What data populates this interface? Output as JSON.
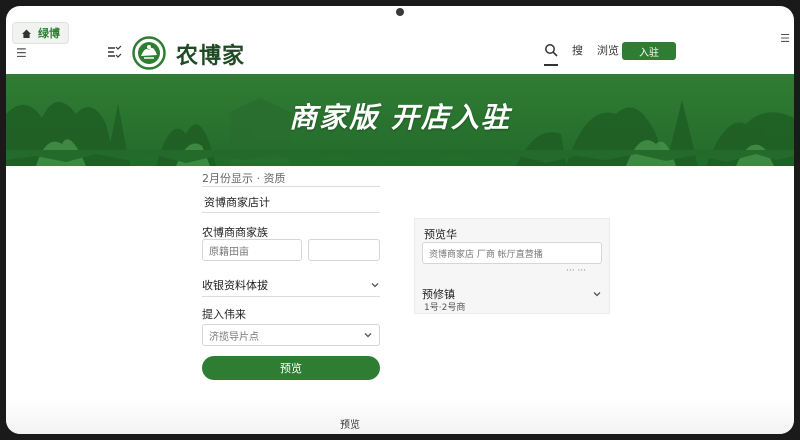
{
  "browser": {
    "tab_label": "绿博",
    "menu_glyph": "☰",
    "right_glyph": "☰"
  },
  "header": {
    "brand": "农博家",
    "nav_items": [
      "搜",
      "浏览"
    ],
    "cta_label": "入驻"
  },
  "hero": {
    "title": "商家版 开店入驻"
  },
  "form": {
    "top_hint": "2月份显示 · 资质",
    "name_value": "资博商家店计",
    "type_label": "农博商商家族",
    "type_placeholder_a": "原籍田亩",
    "type_placeholder_b": "",
    "qualification_select": "收银资料体拔",
    "join_label": "提入伟来",
    "join_select_placeholder": "济揽导片点",
    "submit_label": "预览"
  },
  "panel": {
    "title": "预览华",
    "input_value": "资博商家店 厂商 帐厅直营播",
    "input_meta": "···  ···",
    "section_title": "预修镇",
    "section_sub": "1号·2号商"
  },
  "footer": {
    "label": "预览"
  },
  "colors": {
    "brand_green": "#2e7d32",
    "dark_green": "#1f4b24",
    "hero_green": "#2f7d34"
  },
  "icons": [
    "home-icon",
    "menu-icon",
    "logo-icon",
    "search-icon",
    "chevron-down-icon"
  ]
}
